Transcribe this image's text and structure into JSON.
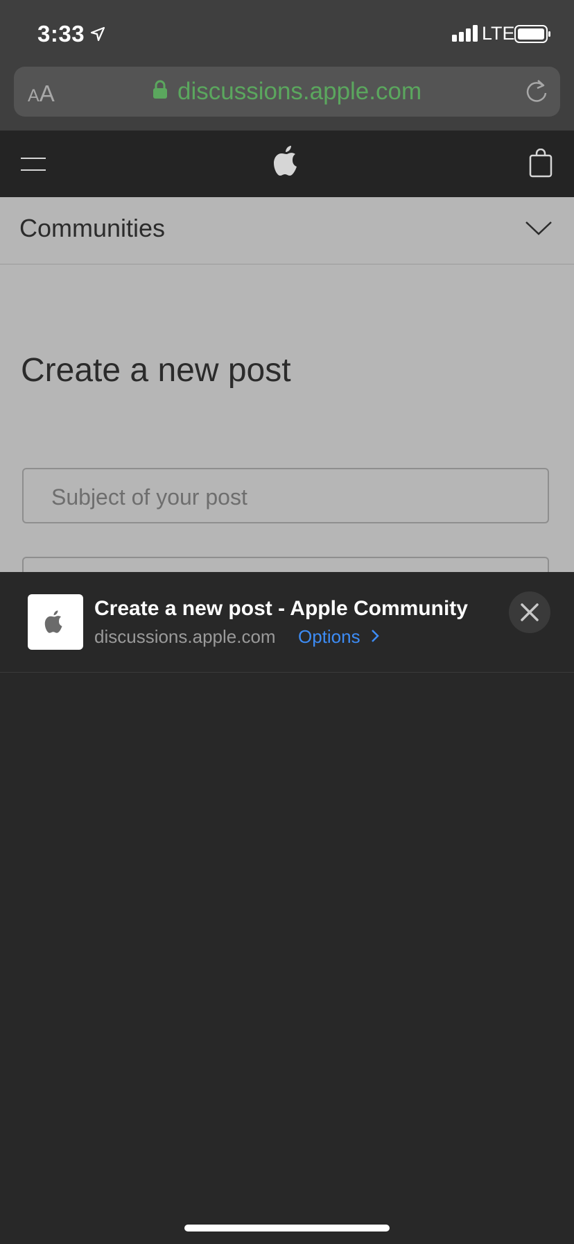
{
  "status": {
    "time": "3:33",
    "network": "LTE",
    "icons": [
      "location-arrow-icon",
      "signal-bars-icon",
      "battery-icon"
    ]
  },
  "browser": {
    "text_size_label": "AA",
    "url": "discussions.apple.com",
    "url_color": "#5ba75e",
    "icons": [
      "lock-icon",
      "reload-icon"
    ]
  },
  "global_nav": {
    "icons": [
      "hamburger-menu-icon",
      "apple-logo-icon",
      "shopping-bag-icon"
    ]
  },
  "page": {
    "section_label": "Communities",
    "title": "Create a new post",
    "subject_placeholder": "Subject of your post"
  },
  "share_sheet": {
    "title": "Create a new post - Apple Community",
    "domain": "discussions.apple.com",
    "options_label": "Options",
    "options_color": "#3d8cf5",
    "icons": [
      "apple-logo-icon",
      "chevron-right-icon",
      "close-icon"
    ]
  },
  "colors": {
    "background": "#282828",
    "page_background": "#b6b6b6",
    "bar_background": "#3f3f3f"
  }
}
